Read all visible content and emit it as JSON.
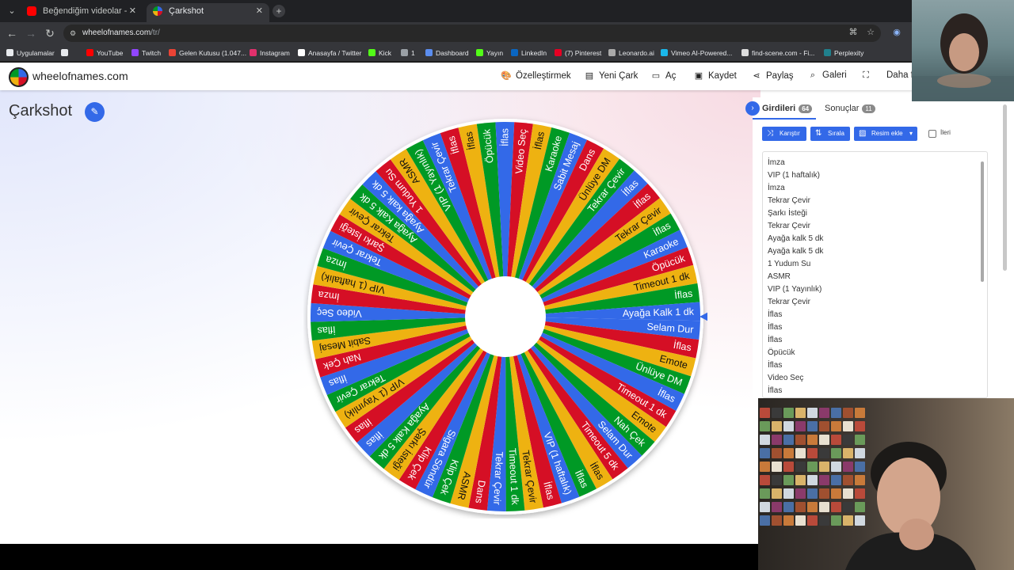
{
  "browser": {
    "tab_list_icon": "chevron-down-icon",
    "tabs": [
      {
        "title": "Beğendiğim videolar - YouTube",
        "favicon_color": "#ff0000",
        "active": false
      },
      {
        "title": "Çarkshot",
        "favicon_color": "#eeb211",
        "active": true
      }
    ],
    "url_host": "wheelofnames.com",
    "url_path": "/tr/",
    "bookmarks": [
      {
        "label": "Uygulamalar",
        "color": "#e8eaed"
      },
      {
        "label": "",
        "color": "#e8eaed"
      },
      {
        "label": "YouTube",
        "color": "#ff0000"
      },
      {
        "label": "Twitch",
        "color": "#9146ff"
      },
      {
        "label": "Gelen Kutusu (1.047...",
        "color": "#ea4335"
      },
      {
        "label": "Instagram",
        "color": "#e1306c"
      },
      {
        "label": "Anasayfa / Twitter",
        "color": "#ffffff"
      },
      {
        "label": "Kick",
        "color": "#53fc18"
      },
      {
        "label": "1",
        "color": "#9aa0a6"
      },
      {
        "label": "Dashboard",
        "color": "#5b8def"
      },
      {
        "label": "Yayın",
        "color": "#53fc18"
      },
      {
        "label": "LinkedIn",
        "color": "#0a66c2"
      },
      {
        "label": "(7) Pinterest",
        "color": "#e60023"
      },
      {
        "label": "Leonardo.ai",
        "color": "#aaaaaa"
      },
      {
        "label": "Vimeo AI-Powered...",
        "color": "#1ab7ea"
      },
      {
        "label": "find-scene.com - Fi...",
        "color": "#dddddd"
      },
      {
        "label": "Perplexity",
        "color": "#20808d"
      }
    ]
  },
  "site": {
    "name": "wheelofnames.com",
    "nav": [
      {
        "label": "Özelleştirmek",
        "icon": "palette-icon"
      },
      {
        "label": "Yeni Çark",
        "icon": "new-file-icon"
      },
      {
        "label": "Aç",
        "icon": "folder-open-icon"
      },
      {
        "label": "Kaydet",
        "icon": "save-icon"
      },
      {
        "label": "Paylaş",
        "icon": "share-icon"
      },
      {
        "label": "Galeri",
        "icon": "search-icon"
      },
      {
        "label": "",
        "icon": "fullscreen-icon"
      },
      {
        "label": "Daha fa",
        "icon": ""
      }
    ],
    "wheel_title": "Çarkshot"
  },
  "wheel": {
    "colors": [
      "#3369e8",
      "#d50f25",
      "#eeb211",
      "#009925"
    ],
    "rotation_deg": 4,
    "segments": [
      "Selam Dur",
      "İflas",
      "Emote",
      "Ünlüye DM",
      "İflas",
      "Timeout 1 dk",
      "Emote",
      "Nah Çek",
      "Selam Dur",
      "Timeout 5 dk",
      "İflas",
      "İflas",
      "VIP (1 haftalık)",
      "İflas",
      "Tekrar Çevir",
      "Timeout 1 dk",
      "Tekrar Çevir",
      "Dans",
      "ASMR",
      "Klip Çek",
      "Sigara Söndür",
      "Klip Çek",
      "Şarkı İsteği",
      "Ayağa Kalk 5 dk",
      "İflas",
      "İflas",
      "VIP (1 Yayınlık)",
      "Tekrar Çevir",
      "İflas",
      "Nah Çek",
      "Sabit Mesaj",
      "İflas",
      "Video Seç",
      "İmza",
      "VIP (1 haftalık)",
      "İmza",
      "Tekrar Çevir",
      "Şarkı İsteği",
      "Tekrar Çevir",
      "Ayağa Kalk 5 dk",
      "Ayağa kalk 5 dk",
      "1 Yudum Su",
      "ASMR",
      "VIP (1 Yayınlık)",
      "Tekrar Çevir",
      "İflas",
      "İflas",
      "Öpücük",
      "İflas",
      "Video Seç",
      "İflas",
      "Karaoke",
      "Sabit Mesaj",
      "Dans",
      "Ünlüye DM",
      "Tekrar Çevir",
      "İflas",
      "İflas",
      "Tekrar Çevir",
      "İflas",
      "Karaoke",
      "Öpücük",
      "Timeout 1 dk",
      "İflas",
      "Ayağa Kalk 1 dk"
    ]
  },
  "sidebar": {
    "tab_entries": {
      "label": "Girdileri",
      "count": "64"
    },
    "tab_results": {
      "label": "Sonuçlar",
      "count": "11"
    },
    "buttons": {
      "shuffle": "Karıştır",
      "sort": "Sırala",
      "add_image": "Resim ekle"
    },
    "advanced_label": "İleri",
    "entries": [
      "İmza",
      "VIP (1 haftalık)",
      "İmza",
      "Tekrar Çevir",
      "Şarkı İsteği",
      "Tekrar Çevir",
      "Ayağa kalk 5 dk",
      "Ayağa kalk 5 dk",
      "1 Yudum Su",
      "ASMR",
      "VIP (1 Yayınlık)",
      "Tekrar Çevir",
      "İflas",
      "İflas",
      "İflas",
      "Öpücük",
      "İflas",
      "Video Seç",
      "İflas"
    ]
  }
}
